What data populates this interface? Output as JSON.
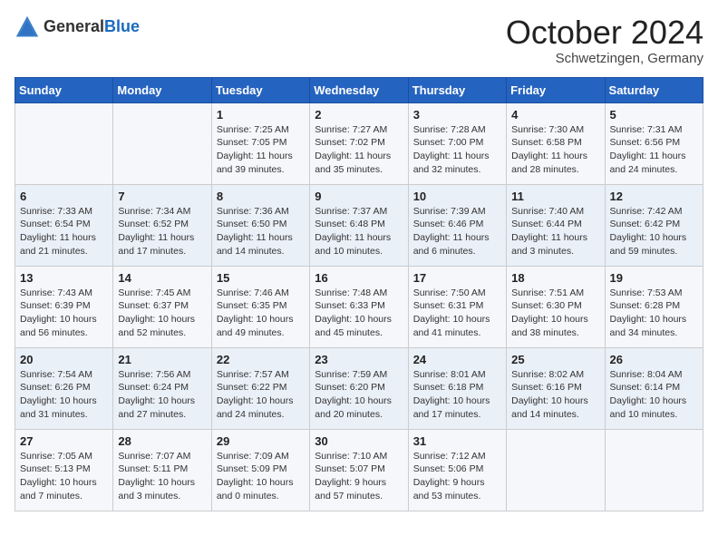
{
  "header": {
    "logo_general": "General",
    "logo_blue": "Blue",
    "month_title": "October 2024",
    "subtitle": "Schwetzingen, Germany"
  },
  "weekdays": [
    "Sunday",
    "Monday",
    "Tuesday",
    "Wednesday",
    "Thursday",
    "Friday",
    "Saturday"
  ],
  "weeks": [
    [
      {
        "day": "",
        "info": ""
      },
      {
        "day": "",
        "info": ""
      },
      {
        "day": "1",
        "info": "Sunrise: 7:25 AM\nSunset: 7:05 PM\nDaylight: 11 hours and 39 minutes."
      },
      {
        "day": "2",
        "info": "Sunrise: 7:27 AM\nSunset: 7:02 PM\nDaylight: 11 hours and 35 minutes."
      },
      {
        "day": "3",
        "info": "Sunrise: 7:28 AM\nSunset: 7:00 PM\nDaylight: 11 hours and 32 minutes."
      },
      {
        "day": "4",
        "info": "Sunrise: 7:30 AM\nSunset: 6:58 PM\nDaylight: 11 hours and 28 minutes."
      },
      {
        "day": "5",
        "info": "Sunrise: 7:31 AM\nSunset: 6:56 PM\nDaylight: 11 hours and 24 minutes."
      }
    ],
    [
      {
        "day": "6",
        "info": "Sunrise: 7:33 AM\nSunset: 6:54 PM\nDaylight: 11 hours and 21 minutes."
      },
      {
        "day": "7",
        "info": "Sunrise: 7:34 AM\nSunset: 6:52 PM\nDaylight: 11 hours and 17 minutes."
      },
      {
        "day": "8",
        "info": "Sunrise: 7:36 AM\nSunset: 6:50 PM\nDaylight: 11 hours and 14 minutes."
      },
      {
        "day": "9",
        "info": "Sunrise: 7:37 AM\nSunset: 6:48 PM\nDaylight: 11 hours and 10 minutes."
      },
      {
        "day": "10",
        "info": "Sunrise: 7:39 AM\nSunset: 6:46 PM\nDaylight: 11 hours and 6 minutes."
      },
      {
        "day": "11",
        "info": "Sunrise: 7:40 AM\nSunset: 6:44 PM\nDaylight: 11 hours and 3 minutes."
      },
      {
        "day": "12",
        "info": "Sunrise: 7:42 AM\nSunset: 6:42 PM\nDaylight: 10 hours and 59 minutes."
      }
    ],
    [
      {
        "day": "13",
        "info": "Sunrise: 7:43 AM\nSunset: 6:39 PM\nDaylight: 10 hours and 56 minutes."
      },
      {
        "day": "14",
        "info": "Sunrise: 7:45 AM\nSunset: 6:37 PM\nDaylight: 10 hours and 52 minutes."
      },
      {
        "day": "15",
        "info": "Sunrise: 7:46 AM\nSunset: 6:35 PM\nDaylight: 10 hours and 49 minutes."
      },
      {
        "day": "16",
        "info": "Sunrise: 7:48 AM\nSunset: 6:33 PM\nDaylight: 10 hours and 45 minutes."
      },
      {
        "day": "17",
        "info": "Sunrise: 7:50 AM\nSunset: 6:31 PM\nDaylight: 10 hours and 41 minutes."
      },
      {
        "day": "18",
        "info": "Sunrise: 7:51 AM\nSunset: 6:30 PM\nDaylight: 10 hours and 38 minutes."
      },
      {
        "day": "19",
        "info": "Sunrise: 7:53 AM\nSunset: 6:28 PM\nDaylight: 10 hours and 34 minutes."
      }
    ],
    [
      {
        "day": "20",
        "info": "Sunrise: 7:54 AM\nSunset: 6:26 PM\nDaylight: 10 hours and 31 minutes."
      },
      {
        "day": "21",
        "info": "Sunrise: 7:56 AM\nSunset: 6:24 PM\nDaylight: 10 hours and 27 minutes."
      },
      {
        "day": "22",
        "info": "Sunrise: 7:57 AM\nSunset: 6:22 PM\nDaylight: 10 hours and 24 minutes."
      },
      {
        "day": "23",
        "info": "Sunrise: 7:59 AM\nSunset: 6:20 PM\nDaylight: 10 hours and 20 minutes."
      },
      {
        "day": "24",
        "info": "Sunrise: 8:01 AM\nSunset: 6:18 PM\nDaylight: 10 hours and 17 minutes."
      },
      {
        "day": "25",
        "info": "Sunrise: 8:02 AM\nSunset: 6:16 PM\nDaylight: 10 hours and 14 minutes."
      },
      {
        "day": "26",
        "info": "Sunrise: 8:04 AM\nSunset: 6:14 PM\nDaylight: 10 hours and 10 minutes."
      }
    ],
    [
      {
        "day": "27",
        "info": "Sunrise: 7:05 AM\nSunset: 5:13 PM\nDaylight: 10 hours and 7 minutes."
      },
      {
        "day": "28",
        "info": "Sunrise: 7:07 AM\nSunset: 5:11 PM\nDaylight: 10 hours and 3 minutes."
      },
      {
        "day": "29",
        "info": "Sunrise: 7:09 AM\nSunset: 5:09 PM\nDaylight: 10 hours and 0 minutes."
      },
      {
        "day": "30",
        "info": "Sunrise: 7:10 AM\nSunset: 5:07 PM\nDaylight: 9 hours and 57 minutes."
      },
      {
        "day": "31",
        "info": "Sunrise: 7:12 AM\nSunset: 5:06 PM\nDaylight: 9 hours and 53 minutes."
      },
      {
        "day": "",
        "info": ""
      },
      {
        "day": "",
        "info": ""
      }
    ]
  ]
}
